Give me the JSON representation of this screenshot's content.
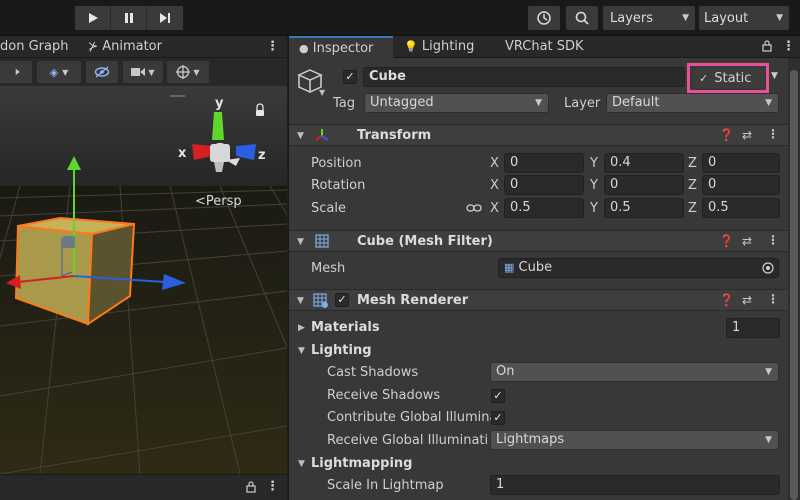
{
  "toolbar": {
    "layers_label": "Layers",
    "layout_label": "Layout"
  },
  "scene": {
    "tabs": [
      "don Graph",
      "Animator"
    ],
    "gizmo_y": "y",
    "gizmo_x": "x",
    "gizmo_z": "z",
    "persp_label": "<Persp"
  },
  "inspector": {
    "tabs": [
      "Inspector",
      "Lighting",
      "VRChat SDK"
    ],
    "object_name": "Cube",
    "static_label": "Static",
    "tag_label": "Tag",
    "tag_value": "Untagged",
    "layer_label": "Layer",
    "layer_value": "Default",
    "transform": {
      "title": "Transform",
      "position_label": "Position",
      "rotation_label": "Rotation",
      "scale_label": "Scale",
      "axis_x": "X",
      "axis_y": "Y",
      "axis_z": "Z",
      "position": [
        "0",
        "0.4",
        "0"
      ],
      "rotation": [
        "0",
        "0",
        "0"
      ],
      "scale": [
        "0.5",
        "0.5",
        "0.5"
      ]
    },
    "mesh_filter": {
      "title": "Cube (Mesh Filter)",
      "mesh_label": "Mesh",
      "mesh_value": "Cube"
    },
    "mesh_renderer": {
      "title": "Mesh Renderer",
      "materials_label": "Materials",
      "materials_count": "1",
      "lighting_label": "Lighting",
      "cast_shadows_label": "Cast Shadows",
      "cast_shadows_value": "On",
      "receive_shadows_label": "Receive Shadows",
      "contribute_gi_label": "Contribute Global Illumina",
      "receive_gi_label": "Receive Global Illuminati",
      "receive_gi_value": "Lightmaps",
      "lightmapping_label": "Lightmapping",
      "scale_lightmap_label": "Scale In Lightmap",
      "scale_lightmap_value": "1"
    }
  },
  "colors": {
    "highlight_box": "#e8509a",
    "cube_fill": "#a89a4a",
    "cube_outline": "#ff7a1a",
    "axis_x": "#d42020",
    "axis_y": "#5fd62b",
    "axis_z": "#2b5fe0"
  }
}
